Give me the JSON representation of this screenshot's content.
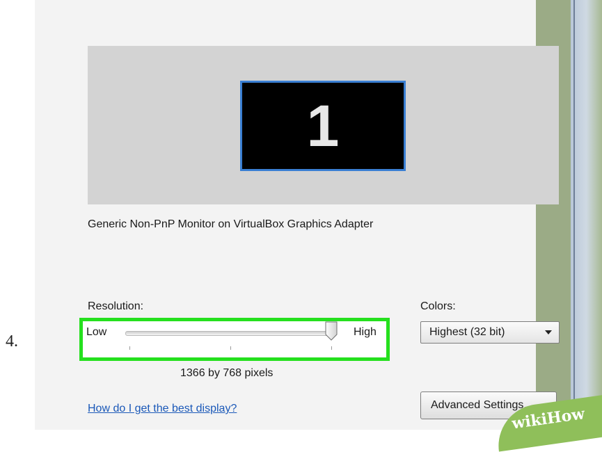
{
  "step_number": "4.",
  "monitor": {
    "number": "1",
    "description": "Generic Non-PnP Monitor on VirtualBox Graphics Adapter"
  },
  "resolution": {
    "label": "Resolution:",
    "low_label": "Low",
    "high_label": "High",
    "value_text": "1366 by 768 pixels",
    "slider_level": 1.0
  },
  "colors": {
    "label": "Colors:",
    "selected": "Highest (32 bit)"
  },
  "help_link": "How do I get the best display?",
  "advanced_button": "Advanced Settings...",
  "watermark": "wikiHow",
  "theme": {
    "highlight": "#25e01e",
    "monitor_border": "#3a7fd3",
    "link": "#1a58b8"
  }
}
